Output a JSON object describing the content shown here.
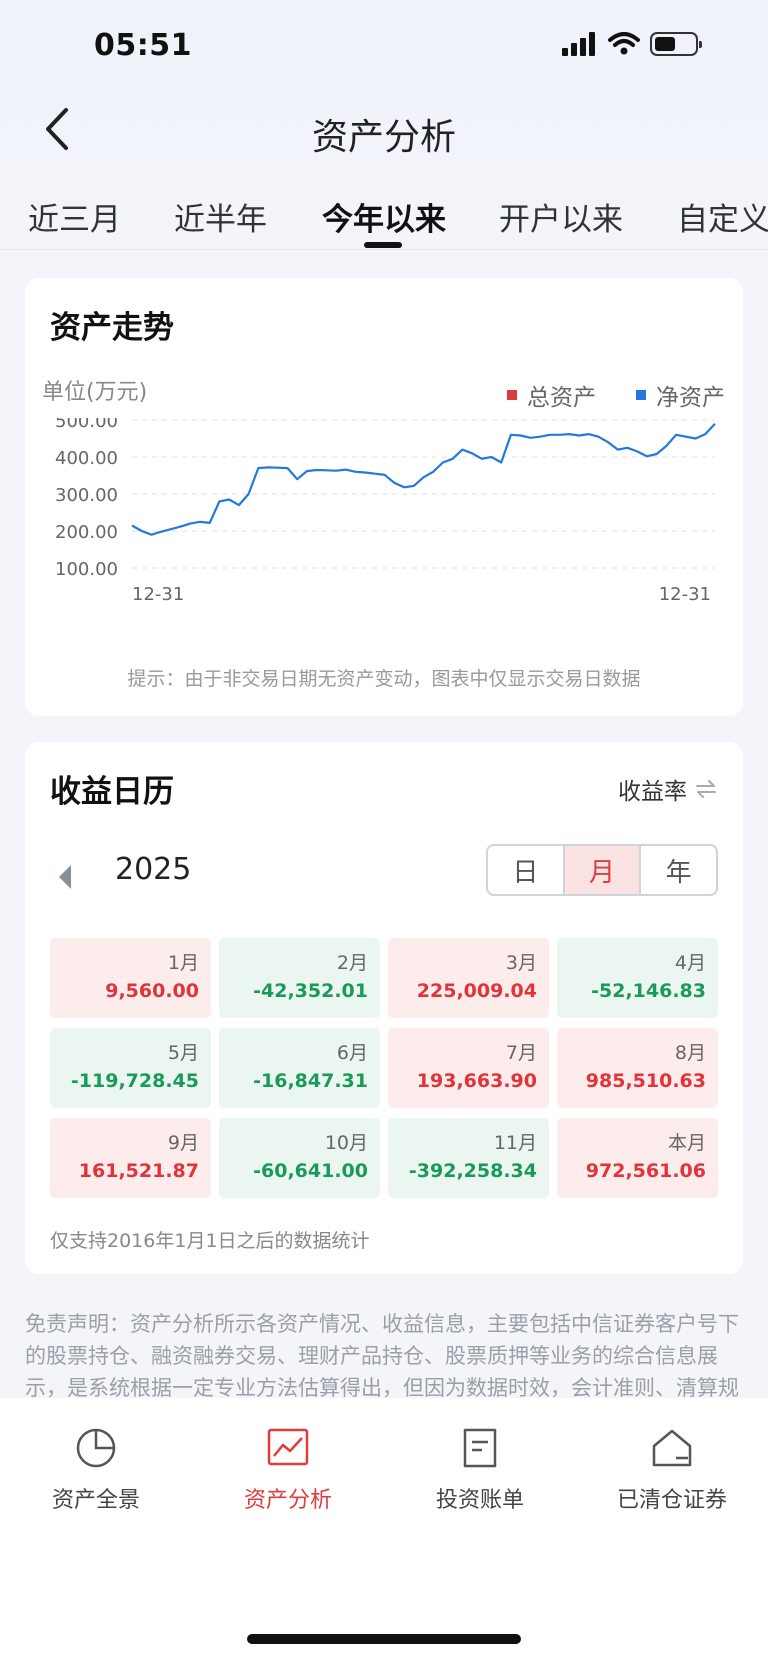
{
  "status": {
    "time": "05:51"
  },
  "nav": {
    "title": "资产分析"
  },
  "tabs": [
    {
      "label": "近三月",
      "active": false
    },
    {
      "label": "近半年",
      "active": false
    },
    {
      "label": "今年以来",
      "active": true
    },
    {
      "label": "开户以来",
      "active": false
    },
    {
      "label": "自定义",
      "active": false
    }
  ],
  "asset_card": {
    "title": "资产走势",
    "unit": "单位(万元)",
    "legend": [
      {
        "label": "总资产",
        "color": "#e23a3a"
      },
      {
        "label": "净资产",
        "color": "#2378e0"
      }
    ],
    "note": "提示：由于非交易日期无资产变动，图表中仅显示交易日数据"
  },
  "chart_data": {
    "type": "line",
    "yticks": [
      "500.00",
      "400.00",
      "300.00",
      "200.00",
      "100.00"
    ],
    "ylim": [
      100,
      500
    ],
    "xlabels": [
      "12-31",
      "12-31"
    ],
    "grid": true,
    "series": [
      {
        "name": "净资产",
        "color": "#2378e0",
        "values": [
          215,
          200,
          190,
          198,
          205,
          212,
          220,
          225,
          222,
          280,
          285,
          270,
          300,
          370,
          372,
          371,
          370,
          340,
          362,
          365,
          364,
          363,
          366,
          360,
          358,
          355,
          352,
          330,
          318,
          322,
          345,
          360,
          385,
          395,
          420,
          410,
          395,
          400,
          385,
          460,
          458,
          452,
          455,
          460,
          460,
          462,
          458,
          462,
          455,
          440,
          420,
          425,
          415,
          402,
          408,
          430,
          460,
          455,
          450,
          462,
          490
        ]
      }
    ]
  },
  "calendar_card": {
    "title": "收益日历",
    "metric_label": "收益率",
    "year": "2025",
    "modes": [
      {
        "label": "日",
        "active": false
      },
      {
        "label": "月",
        "active": true
      },
      {
        "label": "年",
        "active": false
      }
    ],
    "months": [
      {
        "label": "1月",
        "value": "9,560.00",
        "trend": "up"
      },
      {
        "label": "2月",
        "value": "-42,352.01",
        "trend": "down"
      },
      {
        "label": "3月",
        "value": "225,009.04",
        "trend": "up"
      },
      {
        "label": "4月",
        "value": "-52,146.83",
        "trend": "down"
      },
      {
        "label": "5月",
        "value": "-119,728.45",
        "trend": "down"
      },
      {
        "label": "6月",
        "value": "-16,847.31",
        "trend": "down"
      },
      {
        "label": "7月",
        "value": "193,663.90",
        "trend": "up"
      },
      {
        "label": "8月",
        "value": "985,510.63",
        "trend": "up"
      },
      {
        "label": "9月",
        "value": "161,521.87",
        "trend": "up"
      },
      {
        "label": "10月",
        "value": "-60,641.00",
        "trend": "down"
      },
      {
        "label": "11月",
        "value": "-392,258.34",
        "trend": "down"
      },
      {
        "label": "本月",
        "value": "972,561.06",
        "trend": "up"
      }
    ],
    "note": "仅支持2016年1月1日之后的数据统计"
  },
  "disclaimer": "免责声明：资产分析所示各资产情况、收益信息，主要包括中信证券客户号下的股票持仓、融资融券交易、理财产品持仓、股票质押等业务的综合信息展示，是系统根据一定专业方法估算得出，但因为数据时效，会计准则、清算规则、统计方法规则等原因，资产分析所示各资产情况、收益信息，不反映您最终变现后得到的资金和投资收益。相关数据仅作为参考，投资者应自主做出投资决策，自行承担投资风险。",
  "bottom_nav": [
    {
      "label": "资产全景",
      "icon": "pie-chart-icon",
      "active": false
    },
    {
      "label": "资产分析",
      "icon": "line-chart-icon",
      "active": true
    },
    {
      "label": "投资账单",
      "icon": "bill-icon",
      "active": false
    },
    {
      "label": "已清仓证券",
      "icon": "house-icon",
      "active": false
    }
  ],
  "colors": {
    "accent": "#e33b3b",
    "up": "#e0333a",
    "down": "#1a9a5a",
    "line": "#2378e0"
  }
}
